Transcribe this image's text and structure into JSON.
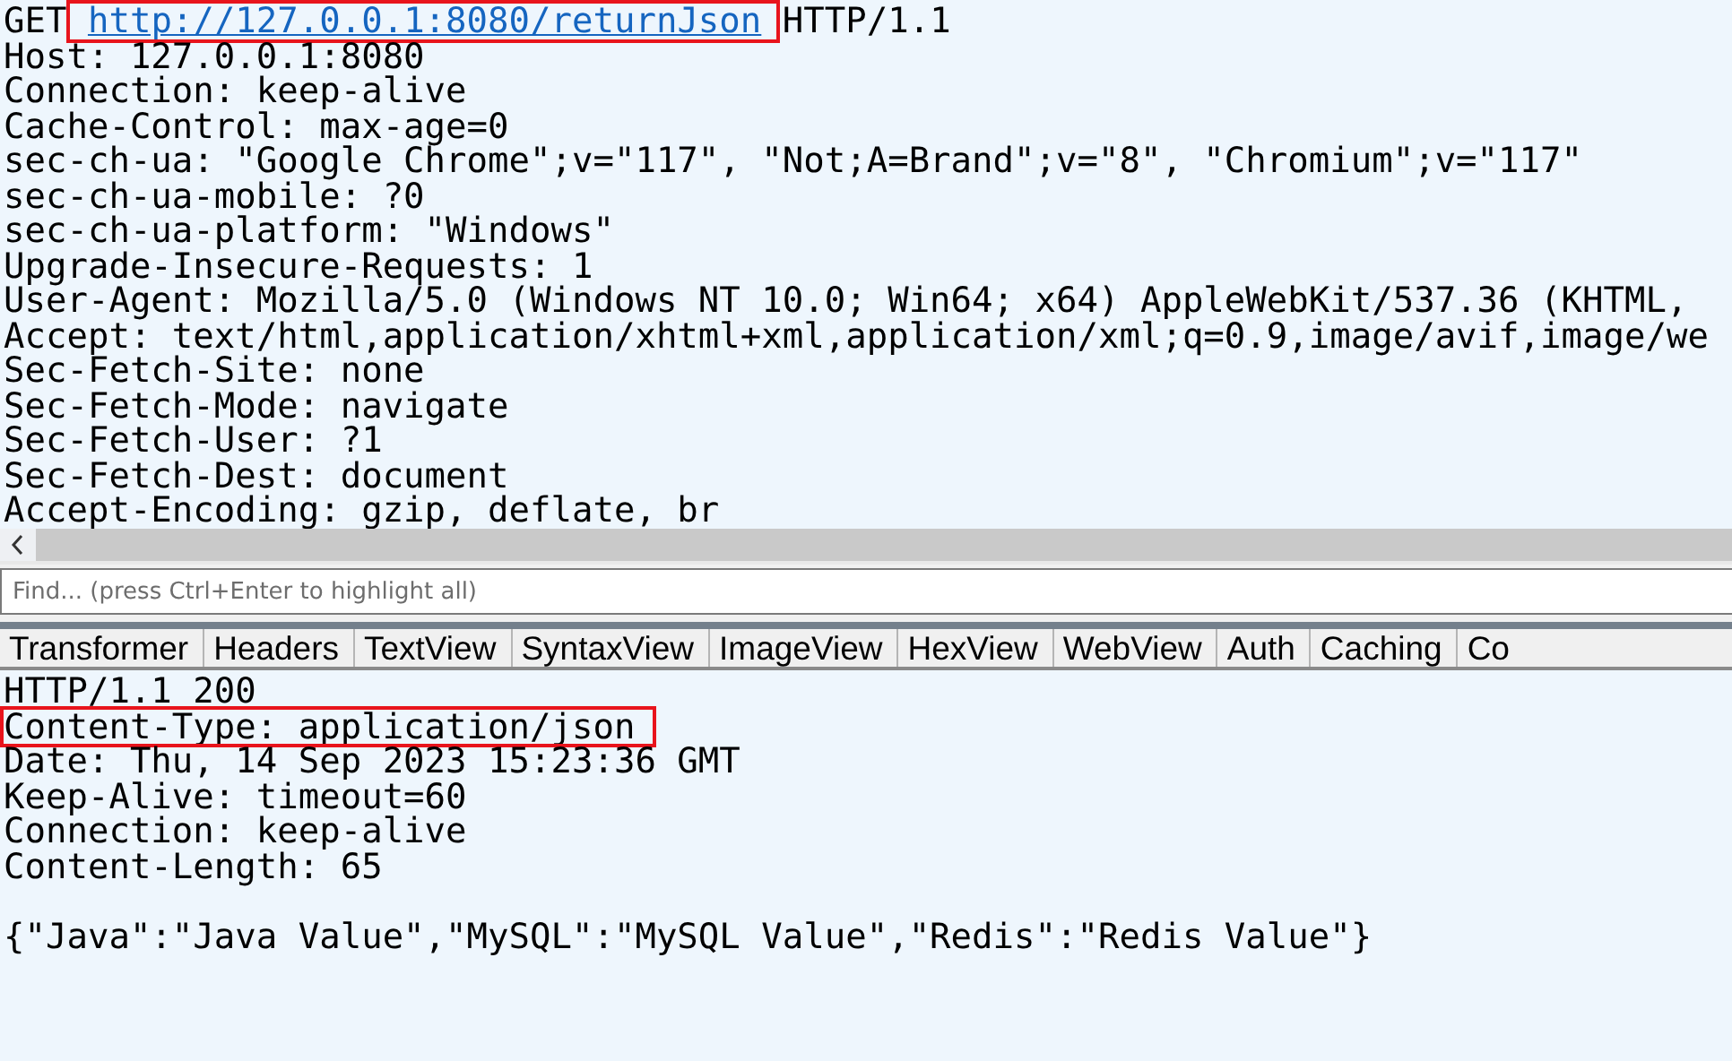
{
  "request": {
    "lines": [
      {
        "segments": [
          {
            "text": "GET ",
            "kind": "plain",
            "highlighted": false
          },
          {
            "text": "http://127.0.0.1:8080/returnJson",
            "kind": "link",
            "highlighted": true
          },
          {
            "text": " HTTP/1.1",
            "kind": "plain",
            "highlighted": false
          }
        ]
      },
      {
        "segments": [
          {
            "text": "Host: 127.0.0.1:8080",
            "kind": "plain",
            "highlighted": false
          }
        ]
      },
      {
        "segments": [
          {
            "text": "Connection: keep-alive",
            "kind": "plain",
            "highlighted": false
          }
        ]
      },
      {
        "segments": [
          {
            "text": "Cache-Control: max-age=0",
            "kind": "plain",
            "highlighted": false
          }
        ]
      },
      {
        "segments": [
          {
            "text": "sec-ch-ua: \"Google Chrome\";v=\"117\", \"Not;A=Brand\";v=\"8\", \"Chromium\";v=\"117\"",
            "kind": "plain",
            "highlighted": false
          }
        ]
      },
      {
        "segments": [
          {
            "text": "sec-ch-ua-mobile: ?0",
            "kind": "plain",
            "highlighted": false
          }
        ]
      },
      {
        "segments": [
          {
            "text": "sec-ch-ua-platform: \"Windows\"",
            "kind": "plain",
            "highlighted": false
          }
        ]
      },
      {
        "segments": [
          {
            "text": "Upgrade-Insecure-Requests: 1",
            "kind": "plain",
            "highlighted": false
          }
        ]
      },
      {
        "segments": [
          {
            "text": "User-Agent: Mozilla/5.0 (Windows NT 10.0; Win64; x64) AppleWebKit/537.36 (KHTML,",
            "kind": "plain",
            "highlighted": false
          }
        ]
      },
      {
        "segments": [
          {
            "text": "Accept: text/html,application/xhtml+xml,application/xml;q=0.9,image/avif,image/we",
            "kind": "plain",
            "highlighted": false
          }
        ]
      },
      {
        "segments": [
          {
            "text": "Sec-Fetch-Site: none",
            "kind": "plain",
            "highlighted": false
          }
        ]
      },
      {
        "segments": [
          {
            "text": "Sec-Fetch-Mode: navigate",
            "kind": "plain",
            "highlighted": false
          }
        ]
      },
      {
        "segments": [
          {
            "text": "Sec-Fetch-User: ?1",
            "kind": "plain",
            "highlighted": false
          }
        ]
      },
      {
        "segments": [
          {
            "text": "Sec-Fetch-Dest: document",
            "kind": "plain",
            "highlighted": false
          }
        ]
      },
      {
        "segments": [
          {
            "text": "Accept-Encoding: gzip, deflate, br",
            "kind": "plain",
            "highlighted": false
          }
        ]
      }
    ]
  },
  "find": {
    "placeholder": "Find... (press Ctrl+Enter to highlight all)"
  },
  "tabs": [
    {
      "label": "Transformer",
      "selected": false
    },
    {
      "label": "Headers",
      "selected": false
    },
    {
      "label": "TextView",
      "selected": false
    },
    {
      "label": "SyntaxView",
      "selected": false
    },
    {
      "label": "ImageView",
      "selected": false
    },
    {
      "label": "HexView",
      "selected": false
    },
    {
      "label": "WebView",
      "selected": false
    },
    {
      "label": "Auth",
      "selected": false
    },
    {
      "label": "Caching",
      "selected": false
    },
    {
      "label": "Co",
      "selected": false
    }
  ],
  "response": {
    "lines": [
      {
        "segments": [
          {
            "text": "HTTP/1.1 200",
            "kind": "plain",
            "highlighted": false
          }
        ]
      },
      {
        "segments": [
          {
            "text": "Content-Type: application/json",
            "kind": "plain",
            "highlighted": true
          }
        ]
      },
      {
        "segments": [
          {
            "text": "Date: Thu, 14 Sep 2023 15:23:36 GMT",
            "kind": "plain",
            "highlighted": false
          }
        ]
      },
      {
        "segments": [
          {
            "text": "Keep-Alive: timeout=60",
            "kind": "plain",
            "highlighted": false
          }
        ]
      },
      {
        "segments": [
          {
            "text": "Connection: keep-alive",
            "kind": "plain",
            "highlighted": false
          }
        ]
      },
      {
        "segments": [
          {
            "text": "Content-Length: 65",
            "kind": "plain",
            "highlighted": false
          }
        ]
      }
    ],
    "body": "{\"Java\":\"Java Value\",\"MySQL\":\"MySQL Value\",\"Redis\":\"Redis Value\"}"
  }
}
